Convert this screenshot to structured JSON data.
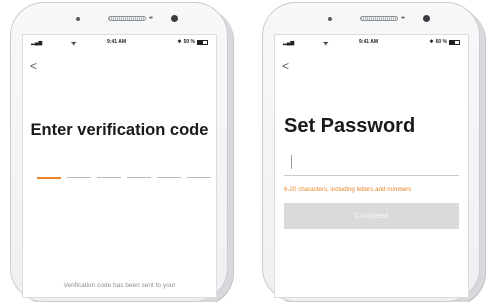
{
  "left_screen": {
    "status": {
      "time": "9:41 AM",
      "battery_text": "50 %",
      "battery_level": 0.5
    },
    "back_glyph": "<",
    "title": "Enter verification code",
    "code_slots": [
      {
        "active": true
      },
      {
        "active": false
      },
      {
        "active": false
      },
      {
        "active": false
      },
      {
        "active": false
      },
      {
        "active": false
      }
    ],
    "sent_text": "Verification code has been sent to your"
  },
  "right_screen": {
    "status": {
      "time": "9:41 AM",
      "battery_text": "60 %",
      "battery_level": 0.6
    },
    "back_glyph": "<",
    "title": "Set Password",
    "password_value": "",
    "hint": "6-20 characters, including letters and numbers",
    "complete_button": "Completed"
  },
  "colors": {
    "accent": "#e8842a",
    "disabled_button": "#d9dadc",
    "text_dark": "#1a1a1a"
  },
  "icons": {
    "signal": "signal-icon",
    "wifi": "wifi-icon",
    "bluetooth": "bluetooth-icon",
    "battery": "battery-icon",
    "back": "back-arrow-icon"
  }
}
